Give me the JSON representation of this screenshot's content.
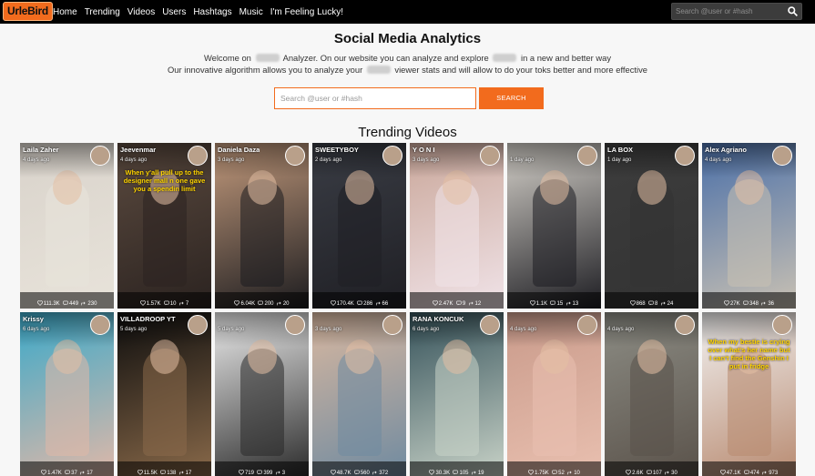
{
  "nav": {
    "logo": "UrleBird",
    "links": [
      "Home",
      "Trending",
      "Videos",
      "Users",
      "Hashtags",
      "Music",
      "I'm Feeling Lucky!"
    ],
    "search_placeholder": "Search @user or #hash"
  },
  "hero": {
    "title": "Social Media Analytics",
    "line1_a": "Welcome on",
    "line1_b": "Analyzer. On our website you can analyze and explore",
    "line1_c": "in a new and better way",
    "line2_a": "Our innovative algorithm allows you to analyze your",
    "line2_b": "viewer stats and will allow to do your toks better and more effective",
    "search_placeholder": "Search @user or #hash",
    "search_button": "SEARCH"
  },
  "trending": {
    "title": "Trending Videos",
    "videos": [
      {
        "author": "Laila Zaher",
        "age": "4 days ago",
        "likes": "111.3K",
        "comments": "449",
        "shares": "230",
        "caption": "",
        "bg": "#d9d3cb",
        "fg": "#e8e3da"
      },
      {
        "author": "Jeevenmar",
        "age": "4 days ago",
        "likes": "1.57K",
        "comments": "10",
        "shares": "7",
        "caption": "When y'all pull up to the designer mall n one gave you a spendin limit",
        "bg": "#5b4a3f",
        "fg": "#2b2320"
      },
      {
        "author": "Daniela Daza",
        "age": "3 days ago",
        "likes": "6.04K",
        "comments": "200",
        "shares": "20",
        "caption": "",
        "bg": "#c49b7d",
        "fg": "#1c1c1f"
      },
      {
        "author": "SWEETYBOY",
        "age": "2 days ago",
        "likes": "170.4K",
        "comments": "286",
        "shares": "66",
        "caption": "",
        "bg": "#3a3d45",
        "fg": "#1f1f24"
      },
      {
        "author": "Y O N I",
        "age": "3 days ago",
        "likes": "2.47K",
        "comments": "9",
        "shares": "12",
        "caption": "",
        "bg": "#caa79a",
        "fg": "#f0e3e8"
      },
      {
        "author": "",
        "age": "1 day ago",
        "likes": "1.1K",
        "comments": "15",
        "shares": "13",
        "caption": "",
        "bg": "#d6d2cb",
        "fg": "#1d1d22"
      },
      {
        "author": "LA BOX",
        "age": "1 day ago",
        "likes": "868",
        "comments": "8",
        "shares": "24",
        "caption": "",
        "bg": "#3d3d3d",
        "fg": "#333333"
      },
      {
        "author": "Alex Agriano",
        "age": "4 days ago",
        "likes": "27K",
        "comments": "348",
        "shares": "36",
        "caption": "",
        "bg": "#4a6fa8",
        "fg": "#c9c1b3"
      },
      {
        "author": "Krissy",
        "age": "6 days ago",
        "likes": "1.47K",
        "comments": "37",
        "shares": "17",
        "caption": "",
        "bg": "#3aa9c9",
        "fg": "#e0b8a8"
      },
      {
        "author": "VILLADROOP YT",
        "age": "5 days ago",
        "likes": "11.5K",
        "comments": "138",
        "shares": "17",
        "caption": "",
        "bg": "#0d0d0d",
        "fg": "#8a6a4a"
      },
      {
        "author": "",
        "age": "5 days ago",
        "likes": "719",
        "comments": "399",
        "shares": "3",
        "caption": "",
        "bg": "#efefef",
        "fg": "#2a2a2a"
      },
      {
        "author": "",
        "age": "3 days ago",
        "likes": "48.7K",
        "comments": "560",
        "shares": "372",
        "caption": "",
        "bg": "#d9b8a0",
        "fg": "#6f8aa0"
      },
      {
        "author": "RANA KONCUK",
        "age": "6 days ago",
        "likes": "30.3K",
        "comments": "105",
        "shares": "19",
        "caption": "",
        "bg": "#35525a",
        "fg": "#c9d3c8"
      },
      {
        "author": "",
        "age": "4 days ago",
        "likes": "1.75K",
        "comments": "52",
        "shares": "10",
        "caption": "",
        "bg": "#c99a8a",
        "fg": "#e9c0b0"
      },
      {
        "author": "",
        "age": "4 days ago",
        "likes": "2.6K",
        "comments": "107",
        "shares": "30",
        "caption": "",
        "bg": "#8d8d85",
        "fg": "#5a524a"
      },
      {
        "author": "",
        "age": "",
        "likes": "47.1K",
        "comments": "474",
        "shares": "973",
        "caption": "When my bestie is crying over what's her name but I can't find the Genshin I put in fridge",
        "bg": "#f2f2f2",
        "fg": "#b88a70"
      }
    ]
  },
  "colors": {
    "accent": "#f26b1d",
    "navbar": "#000000",
    "page": "#f7f7f7"
  },
  "icons": {
    "nav_search": "search-icon",
    "likes": "heart-icon",
    "comments": "comment-icon",
    "shares": "share-icon"
  }
}
